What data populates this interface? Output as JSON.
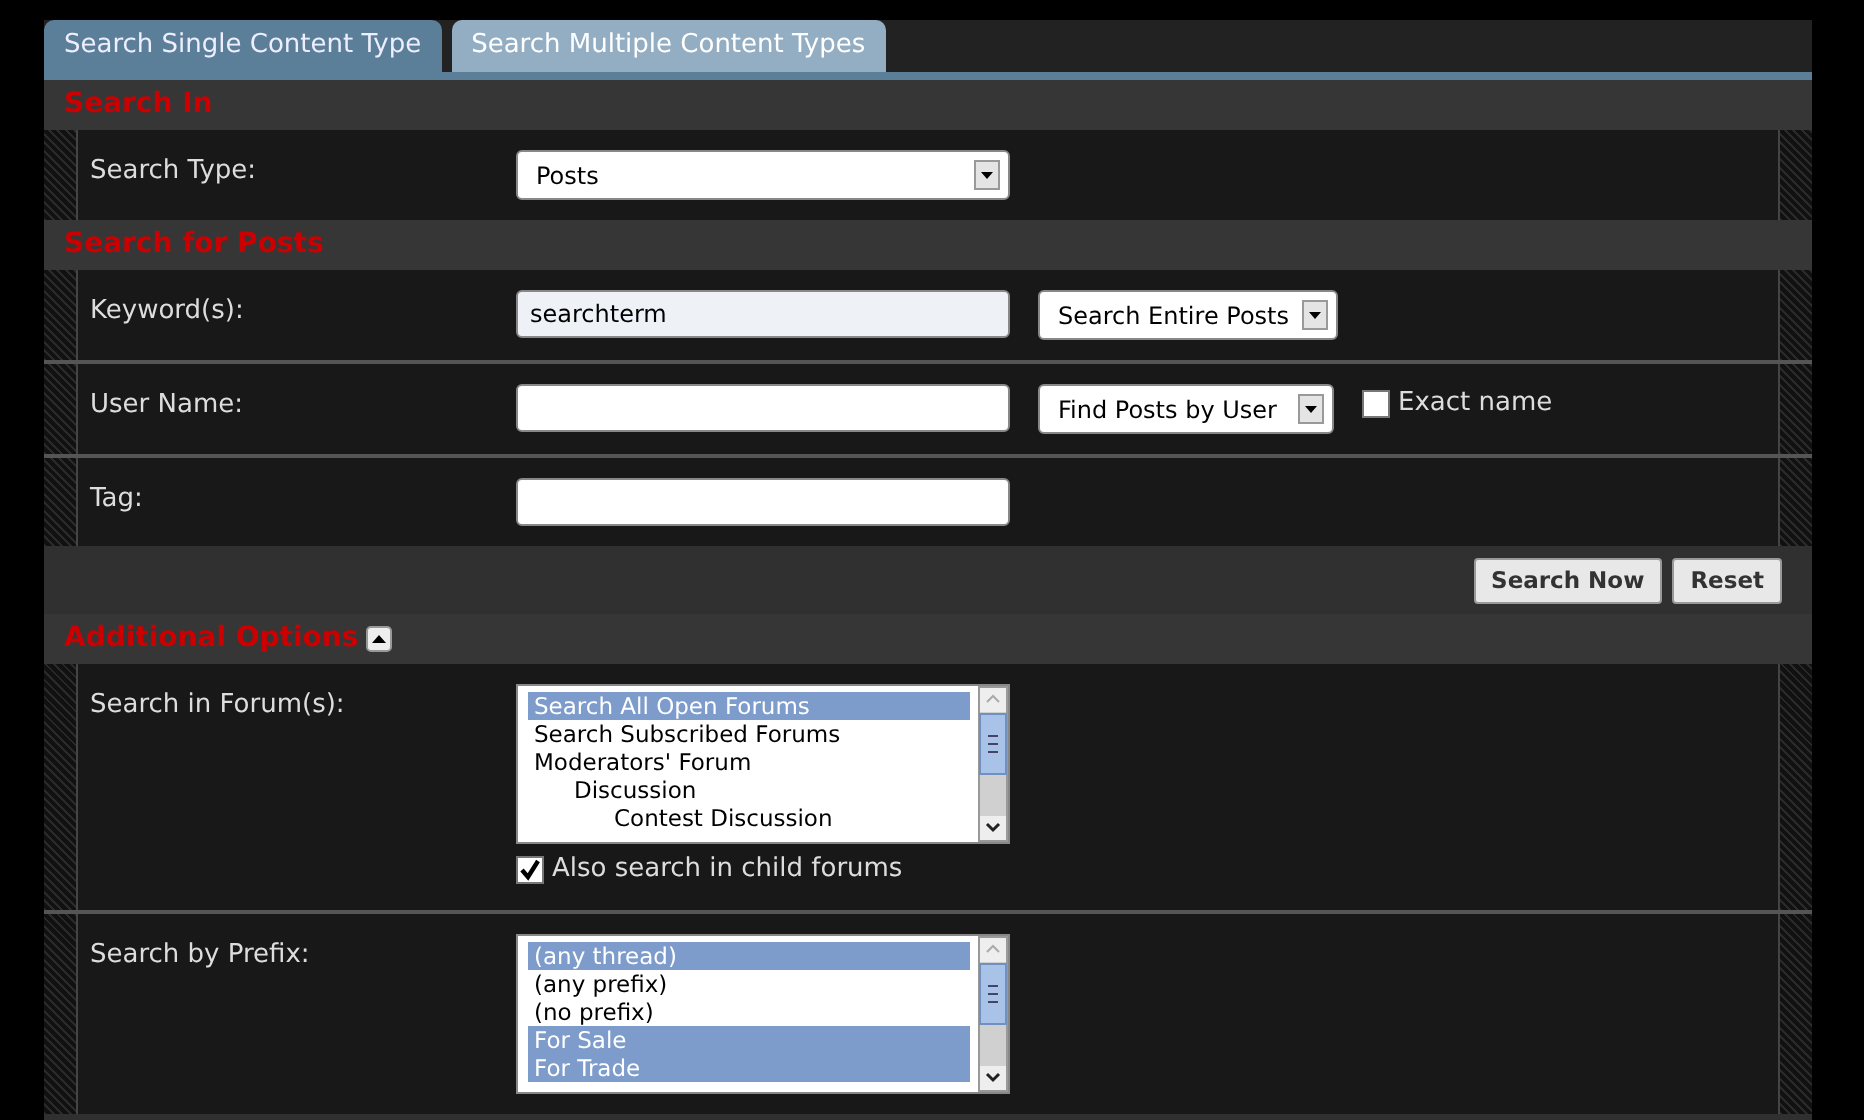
{
  "tabs": [
    {
      "label": "Search Single Content Type",
      "selected": true
    },
    {
      "label": "Search Multiple Content Types",
      "selected": false
    }
  ],
  "sections": [
    {
      "title": "Search In",
      "rows": [
        {
          "label": "Search Type:",
          "controls": [
            {
              "kind": "select",
              "value": "Posts"
            }
          ]
        }
      ]
    },
    {
      "title": "Search for Posts",
      "rows": [
        {
          "label": "Keyword(s):",
          "controls": [
            {
              "kind": "text",
              "value": "searchterm",
              "focused": true
            },
            {
              "kind": "select",
              "value": "Search Entire Posts"
            }
          ]
        },
        {
          "label": "User Name:",
          "controls": [
            {
              "kind": "text",
              "focused": false
            },
            {
              "kind": "select",
              "value": "Find Posts by User"
            },
            {
              "kind": "checkbox",
              "label": "Exact name",
              "checked": false
            }
          ]
        },
        {
          "label": "Tag:",
          "controls": [
            {
              "kind": "text",
              "focused": false
            }
          ]
        }
      ],
      "buttons": [
        "Search Now",
        "Reset"
      ]
    },
    {
      "title": "Additional Options",
      "expanded": true,
      "rows": [
        {
          "label": "Search in Forum(s):",
          "controls": [
            {
              "kind": "listbox",
              "items": [
                {
                  "label": "Search All Open Forums",
                  "selected": true
                },
                {
                  "label": "Search Subscribed Forums",
                  "selected": false
                },
                {
                  "label": "Moderators' Forum",
                  "selected": false,
                  "children": [
                    {
                      "label": "Discussion",
                      "selected": false,
                      "children": [
                        {
                          "label": "Contest Discussion",
                          "selected": false
                        }
                      ]
                    }
                  ]
                }
              ]
            },
            {
              "kind": "checkbox",
              "label": "Also search in child forums",
              "checked": true
            }
          ]
        },
        {
          "label": "Search by Prefix:",
          "controls": [
            {
              "kind": "listbox",
              "items": [
                {
                  "label": "(any thread)",
                  "selected": true
                },
                {
                  "label": "(any prefix)",
                  "selected": false
                },
                {
                  "label": "(no prefix)",
                  "selected": false
                },
                {
                  "label": "For Sale",
                  "selected": true
                },
                {
                  "label": "For Trade",
                  "selected": true
                }
              ]
            }
          ]
        }
      ]
    }
  ]
}
